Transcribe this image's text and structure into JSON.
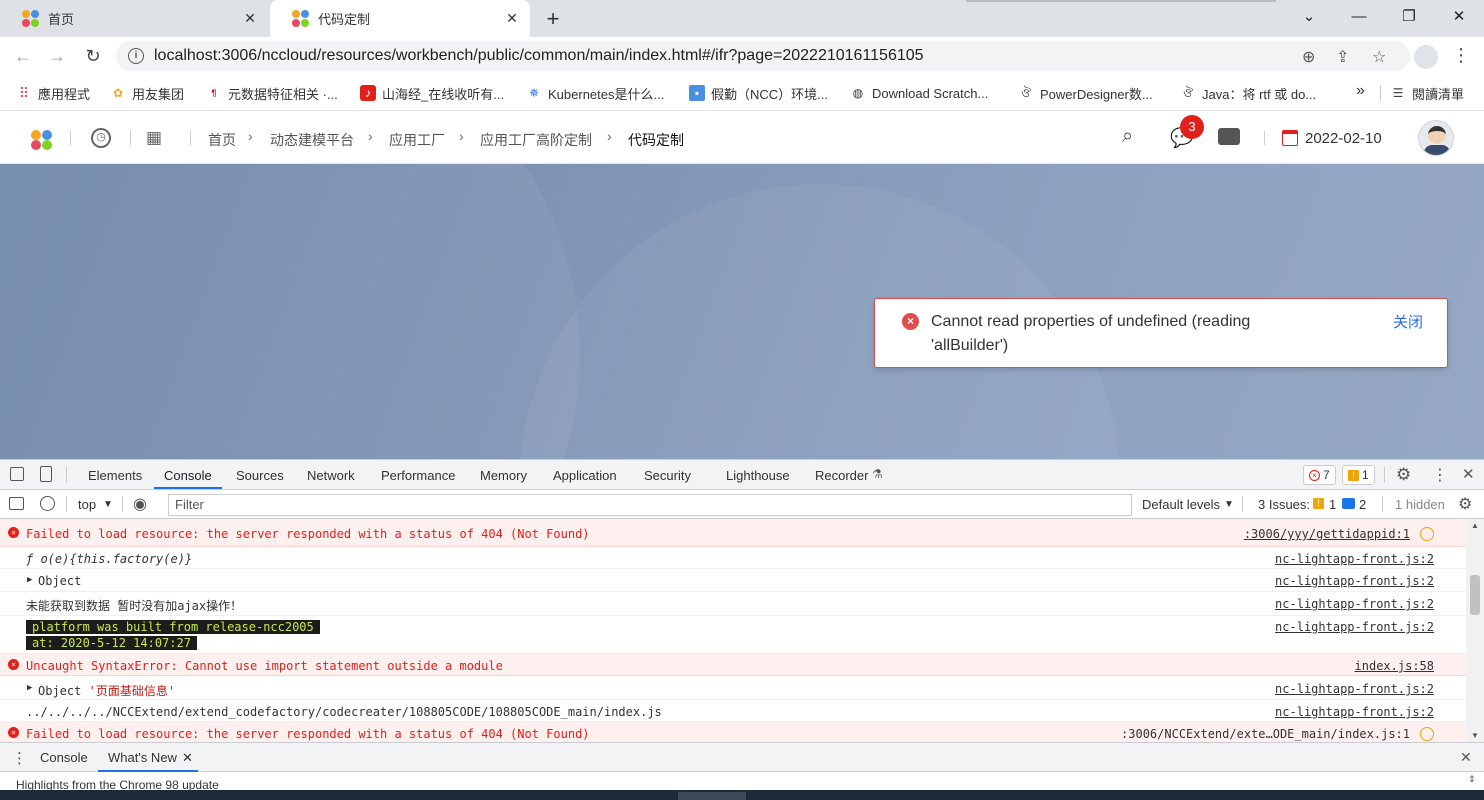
{
  "browser": {
    "tabs": [
      {
        "title": "首页",
        "close": "✕"
      },
      {
        "title": "代码定制",
        "close": "✕"
      }
    ],
    "new_tab": "+",
    "window_controls": {
      "minimize": "—",
      "restore": "❐",
      "close": "✕",
      "dropdown": "⌄"
    },
    "url": "localhost:3006/nccloud/resources/workbench/public/common/main/index.html#/ifr?page=2022210161156105",
    "bookmarks": [
      "應用程式",
      "用友集团",
      "元数据特征相关 ·...",
      "山海经_在线收听有...",
      "Kubernetes是什么...",
      "假勤（NCC）环境...",
      "Download Scratch...",
      "PowerDesigner数...",
      "Java：将 rtf 或 do..."
    ],
    "bookmarks_more": "»",
    "reading_list": "閱讀清單"
  },
  "app": {
    "breadcrumb": [
      "首页",
      "动态建模平台",
      "应用工厂",
      "应用工厂高阶定制",
      "代码定制"
    ],
    "notification_count": "3",
    "date": "2022-02-10"
  },
  "toast": {
    "message": "Cannot read properties of undefined (reading 'allBuilder')",
    "close_label": "关闭"
  },
  "devtools": {
    "tabs": [
      "Elements",
      "Console",
      "Sources",
      "Network",
      "Performance",
      "Memory",
      "Application",
      "Security",
      "Lighthouse",
      "Recorder"
    ],
    "active_tab": "Console",
    "error_count": "7",
    "warning_count": "1",
    "context": "top",
    "filter_placeholder": "Filter",
    "levels": "Default levels",
    "issues_label": "3 Issues:",
    "issues_warn": "1",
    "issues_info": "2",
    "hidden": "1 hidden",
    "log": [
      {
        "type": "error",
        "text": "Failed to load resource: the server responded with a status of 404 (Not Found)",
        "source": ":3006/yyy/gettidappid:1"
      },
      {
        "type": "log",
        "text": "ƒ o(e){this.factory(e)}",
        "source": "nc-lightapp-front.js:2"
      },
      {
        "type": "object",
        "text": "Object",
        "source": "nc-lightapp-front.js:2"
      },
      {
        "type": "log",
        "text": "未能获取到数据 暂时没有加ajax操作！",
        "source": "nc-lightapp-front.js:2"
      },
      {
        "type": "banner",
        "line1": "platform was built from release-ncc2005",
        "line2": "at: 2020-5-12 14:07:27",
        "source": "nc-lightapp-front.js:2"
      },
      {
        "type": "error",
        "text": "Uncaught SyntaxError: Cannot use import statement outside a module",
        "source": "index.js:58"
      },
      {
        "type": "object",
        "text": "Object",
        "str": "'页面基础信息'",
        "source": "nc-lightapp-front.js:2"
      },
      {
        "type": "log",
        "text": "../../../../NCCExtend/extend_codefactory/codecreater/108805CODE/108805CODE_main/index.js",
        "source": "nc-lightapp-front.js:2"
      },
      {
        "type": "error",
        "text": "Failed to load resource: the server responded with a status of 404 (Not Found)",
        "source": ":3006/NCCExtend/exte…ODE_main/index.js:1"
      }
    ],
    "drawer_tabs": [
      "Console",
      "What's New"
    ],
    "drawer_text": "Highlights from the Chrome 98 update"
  }
}
